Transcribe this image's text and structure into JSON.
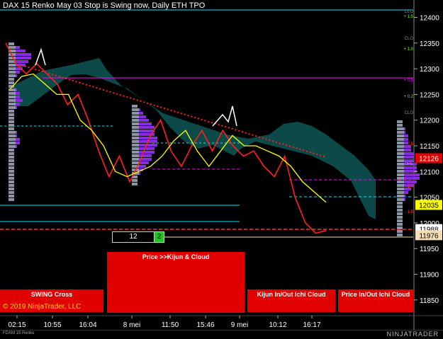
{
  "header": {
    "title": "DAX 15 Renko May 03  Stop is Swing now, Daily ETH TPO"
  },
  "panels": {
    "swing": "SWING Cross",
    "kijun_cloud": "Price >>Kijun & Cloud",
    "kijun_ichi": "Kijun In/Out Ichi Cloud",
    "price_ichi": "Price In/Out Ichi Cloud"
  },
  "copyright": "© 2019 NinjaTrader, LLC",
  "counters": {
    "bars": "12",
    "count": "2"
  },
  "footer": {
    "instrument": "FDXM 15 Renko",
    "logo": "NINJATRADER"
  },
  "axis": {
    "y_ticks": [
      "12400",
      "12350",
      "12300",
      "12250",
      "12200",
      "12150",
      "12100",
      "12050",
      "12000",
      "11950",
      "11900",
      "11850"
    ],
    "x_ticks": [
      "02:15",
      "10:55",
      "16:04",
      "8 mei",
      "11:50",
      "15:46",
      "9 mei",
      "10:12",
      "16:17"
    ],
    "price_tags": [
      {
        "label": "12126",
        "color": "#e00000",
        "text": "#ffffff",
        "value": 12126
      },
      {
        "label": "12035",
        "color": "#ffff00",
        "text": "#000000",
        "value": 12035
      },
      {
        "label": "11988",
        "color": "#ffffff",
        "text": "#000000",
        "value": 11988
      },
      {
        "label": "11976",
        "color": "#f5deb3",
        "text": "#000000",
        "value": 11976
      }
    ]
  },
  "right_labels": [
    "CLO",
    "+ 1.5",
    "CLO",
    "+ 1.0",
    "+ 0.5",
    "+ 0.2",
    "CLO",
    "- 0.5",
    "OPE",
    "- 1.0",
    "- 1.5"
  ],
  "colors": {
    "price_line": "#ff2020",
    "kijun_line": "#ffff00",
    "cloud": "#0d4d4d",
    "tpo": "#8a2be2",
    "poc_line": "#ff3333",
    "cyan_line": "#00e5ff",
    "magenta_line": "#ff00ff"
  },
  "chart_data": {
    "type": "line",
    "ylim": [
      11825,
      12420
    ],
    "series": [
      {
        "values": [
          12350,
          12310,
          12290,
          12310,
          12290,
          12270,
          12230,
          12250,
          12200,
          12140,
          12090,
          12130,
          12080,
          12120,
          12170,
          12200,
          12140,
          12110,
          12150,
          12180,
          12140,
          12180,
          12150,
          12130,
          12140,
          12110,
          12090,
          12130,
          12050,
          12000,
          11980,
          11985
        ]
      },
      {
        "values": [
          12260,
          12285,
          12290,
          12270,
          12250,
          12250,
          12200,
          12180,
          12150,
          12100,
          12090,
          12100,
          12110,
          12130,
          12160,
          12180,
          12140,
          12110,
          12140,
          12170,
          12150,
          12150,
          12140,
          12130,
          12110,
          12080,
          12060,
          12040
        ]
      }
    ]
  }
}
